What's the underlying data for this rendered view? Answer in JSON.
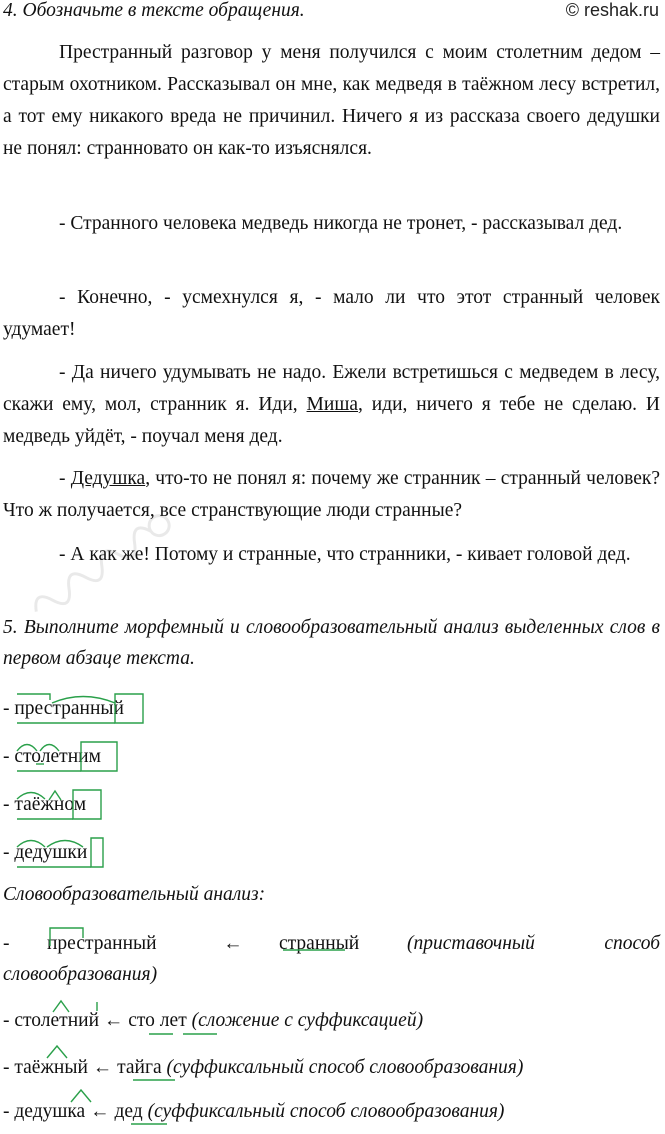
{
  "header": {
    "task4_title": "4. Обозначьте в тексте обращения.",
    "copyright": "© reshak.ru"
  },
  "text": {
    "p1": "Престранный разговор у меня получился с моим столетним дедом – старым охотником. Рассказывал он мне, как медведя в таёжном лесу встретил, а тот ему никакого вреда не причинил. Ничего я из рассказа своего дедушки не понял: странновато он как-то изъяснялся.",
    "p2": "- Странного человека медведь никогда не тронет, - рассказывал дед.",
    "p3": "- Конечно, - усмехнулся я, - мало ли что этот странный человек удумает!",
    "p4_a": "- Да ничего удумывать не надо. Ежели встретишься с медведем в лесу, скажи ему, мол, странник я. Иди, ",
    "p4_address": "Миша",
    "p4_b": ", иди, ничего я тебе не сделаю. И медведь уйдёт, - поучал меня дед.",
    "p5_a": "- ",
    "p5_address": "Дедушка",
    "p5_b": ", что-то не понял я: почему же странник – странный человек? Что ж получается, все странствующие люди странные?",
    "p6": "- А как же! Потому и странные, что странники, - кивает головой дед."
  },
  "task5": {
    "title": "5. Выполните морфемный и словообразовательный анализ выделенных слов в первом абзаце текста."
  },
  "morphemic": [
    {
      "dash": "- ",
      "word": "престранный"
    },
    {
      "dash": "- ",
      "word": "столетним"
    },
    {
      "dash": "- ",
      "word": "таёжном"
    },
    {
      "dash": "- ",
      "word": "дедушки"
    }
  ],
  "word_formation": {
    "title": "Словообразовательный анализ:",
    "rows": [
      {
        "dash": "-",
        "word": "престранный",
        "arrow": "←",
        "source": "странный",
        "note": "(приставочный способ словообразования)"
      },
      {
        "dash": "- ",
        "word": "столетний",
        "arrow": "←",
        "source": "сто лет",
        "note": "(сложение с суффиксацией)"
      },
      {
        "dash": "- ",
        "word": "таёжный",
        "arrow": "←",
        "source": "тайга",
        "note": "(суффиксальный способ словообразования)"
      },
      {
        "dash": "- ",
        "word": "дедушка",
        "arrow": "←",
        "source": "дед",
        "note": "(суффиксальный способ словообразования)"
      }
    ]
  },
  "colors": {
    "morpheme_marks": "#2aa04a",
    "text": "#111111"
  }
}
